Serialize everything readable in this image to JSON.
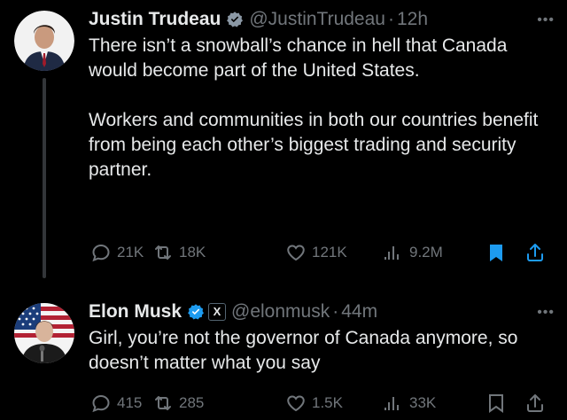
{
  "colors": {
    "background": "#000000",
    "text": "#e7e9ea",
    "muted": "#71767b",
    "verified": "#1d9bf0",
    "bookmark_active": "#1d9bf0"
  },
  "tweets": [
    {
      "name": "Justin Trudeau",
      "handle": "@JustinTrudeau",
      "dot": "·",
      "time": "12h",
      "more": "•••",
      "text": "There isn’t a snowball’s chance in hell that Canada would become part of the United States.\n\nWorkers and communities in both our countries benefit from being each other’s biggest trading and security partner.",
      "stats": {
        "replies": "21K",
        "reposts": "18K",
        "likes": "121K",
        "views": "9.2M"
      },
      "bookmarked": true,
      "affiliate_label": null
    },
    {
      "name": "Elon Musk",
      "handle": "@elonmusk",
      "dot": "·",
      "time": "44m",
      "more": "•••",
      "text": "Girl, you’re not the governor of Canada anymore, so doesn’t matter what you say",
      "stats": {
        "replies": "415",
        "reposts": "285",
        "likes": "1.5K",
        "views": "33K"
      },
      "bookmarked": false,
      "affiliate_label": "X"
    }
  ]
}
